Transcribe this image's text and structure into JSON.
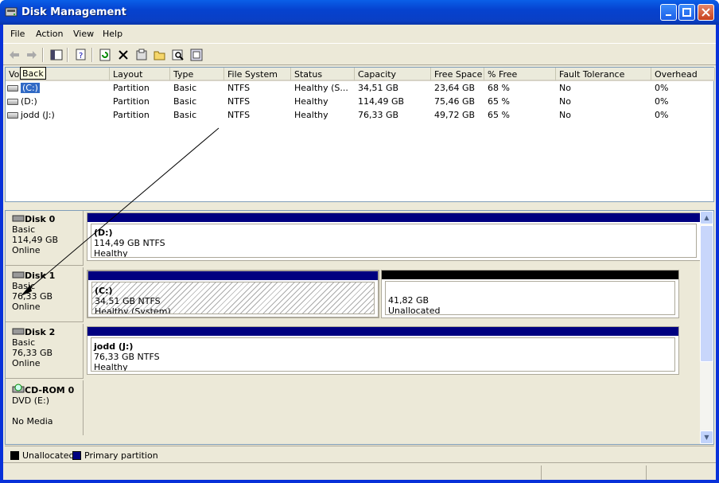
{
  "window": {
    "title": "Disk Management"
  },
  "menu": [
    "File",
    "Action",
    "View",
    "Help"
  ],
  "toolbar": {
    "icons": [
      "back-icon",
      "forward-icon",
      "console-tree-icon",
      "properties-icon",
      "refresh-icon",
      "delete-icon",
      "help-icon",
      "open-icon",
      "search-icon",
      "export-icon"
    ]
  },
  "tooltip": "Back",
  "columns": [
    "Volume",
    "Layout",
    "Type",
    "File System",
    "Status",
    "Capacity",
    "Free Space",
    "% Free",
    "Fault Tolerance",
    "Overhead"
  ],
  "volumes": [
    {
      "volume": "(C:)",
      "layout": "Partition",
      "type": "Basic",
      "fs": "NTFS",
      "status": "Healthy (S...",
      "capacity": "34,51 GB",
      "free": "23,64 GB",
      "pct": "68 %",
      "fault": "No",
      "overhead": "0%"
    },
    {
      "volume": "(D:)",
      "layout": "Partition",
      "type": "Basic",
      "fs": "NTFS",
      "status": "Healthy",
      "capacity": "114,49 GB",
      "free": "75,46 GB",
      "pct": "65 %",
      "fault": "No",
      "overhead": "0%"
    },
    {
      "volume": "jodd (J:)",
      "layout": "Partition",
      "type": "Basic",
      "fs": "NTFS",
      "status": "Healthy",
      "capacity": "76,33 GB",
      "free": "49,72 GB",
      "pct": "65 %",
      "fault": "No",
      "overhead": "0%"
    }
  ],
  "disks": [
    {
      "name": "Disk 0",
      "type": "Basic",
      "size": "114,49 GB",
      "state": "Online",
      "partitions": [
        {
          "label": "(D:)",
          "size": "114,49 GB NTFS",
          "status": "Healthy"
        }
      ]
    },
    {
      "name": "Disk 1",
      "type": "Basic",
      "size": "76,33 GB",
      "state": "Online",
      "partitions": [
        {
          "label": "(C:)",
          "size": "34,51 GB NTFS",
          "status": "Healthy (System)"
        },
        {
          "label": "",
          "size": "41,82 GB",
          "status": "Unallocated"
        }
      ]
    },
    {
      "name": "Disk 2",
      "type": "Basic",
      "size": "76,33 GB",
      "state": "Online",
      "partitions": [
        {
          "label": "jodd  (J:)",
          "size": "76,33 GB NTFS",
          "status": "Healthy"
        }
      ]
    },
    {
      "name": "CD-ROM 0",
      "type": "DVD (E:)",
      "size": "",
      "state": "No Media",
      "partitions": []
    }
  ],
  "legend": {
    "unallocated": "Unallocated",
    "primary": "Primary partition"
  },
  "colors": {
    "primary": "#000080",
    "unallocated": "#000000",
    "titlebar": "#0a3fc4"
  }
}
